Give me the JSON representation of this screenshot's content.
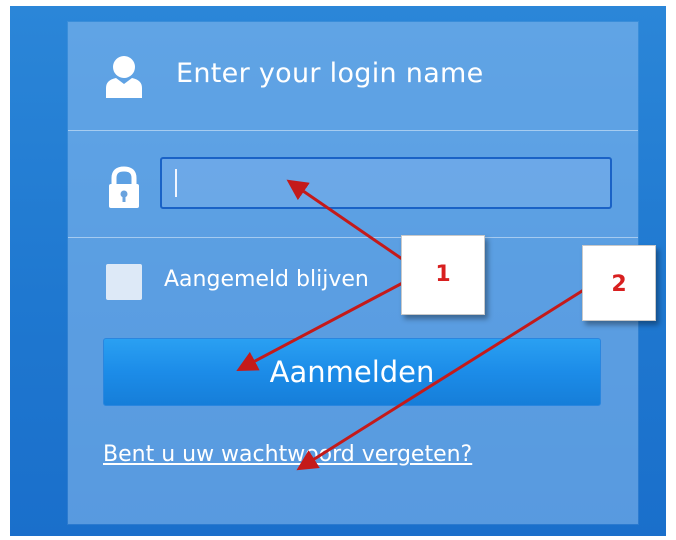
{
  "login_form": {
    "username_label": "Enter your login name",
    "password_value": "",
    "remember_label": "Aangemeld blijven",
    "remember_checked": false,
    "submit_label": "Aanmelden",
    "forgot_link_label": "Bent u uw wachtwoord vergeten?"
  },
  "annotations": {
    "callout_1": "1",
    "callout_2": "2"
  },
  "icons": {
    "user": "user-icon",
    "lock": "lock-icon"
  },
  "colors": {
    "background": "#1f78d0",
    "panel": "#5f9fdf",
    "button": "#1c8ce8",
    "input_border": "#1a62c6",
    "annotation_red": "#c41a1a"
  }
}
